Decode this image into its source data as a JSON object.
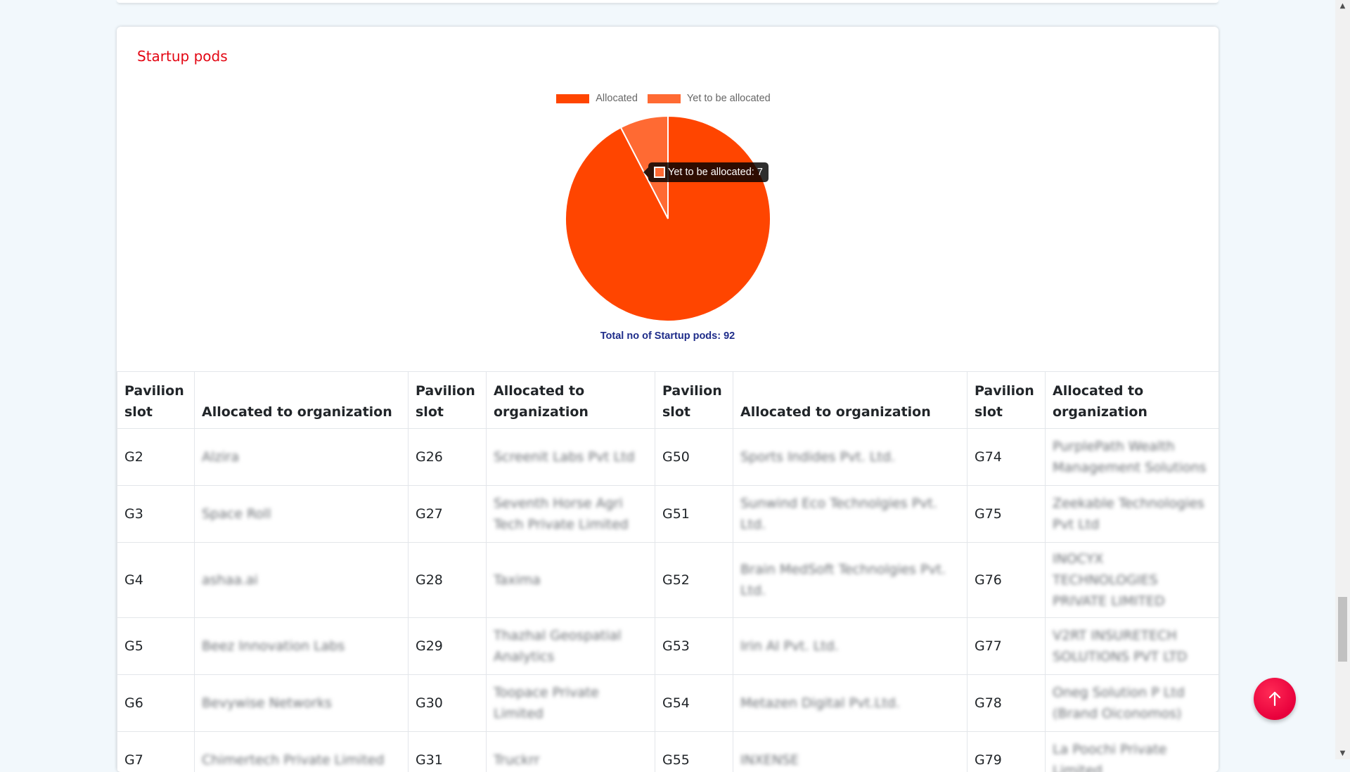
{
  "section": {
    "title": "Startup pods"
  },
  "chart_data": {
    "type": "pie",
    "labels": [
      "Allocated",
      "Yet to be allocated"
    ],
    "values": [
      85,
      7
    ],
    "colors": [
      "#ff4500",
      "#ff6a33"
    ],
    "legend_position": "top",
    "tooltip": "Yet to be allocated: 7",
    "caption": "Total no of Startup pods: 92"
  },
  "table": {
    "headers": [
      "Pavilion slot",
      "Allocated to organization",
      "Pavilion slot",
      "Allocated to organization",
      "Pavilion slot",
      "Allocated to organization",
      "Pavilion slot",
      "Allocated to organization"
    ],
    "rows": [
      [
        "G2",
        "Alzira",
        "G26",
        "Screenit Labs Pvt Ltd",
        "G50",
        "Sports Indides Pvt. Ltd.",
        "G74",
        "PurplePath Wealth Management Solutions"
      ],
      [
        "G3",
        "Space Roll",
        "G27",
        "Seventh Horse Agri Tech Private Limited",
        "G51",
        "Sunwind Eco Technolgies Pvt. Ltd.",
        "G75",
        "Zeekable Technologies Pvt Ltd"
      ],
      [
        "G4",
        "ashaa.ai",
        "G28",
        "Taxima",
        "G52",
        "Brain MedSoft Technolgies Pvt. Ltd.",
        "G76",
        "INOCYX TECHNOLOGIES PRIVATE LIMITED"
      ],
      [
        "G5",
        "Beez Innovation Labs",
        "G29",
        "Thazhal Geospatial Analytics",
        "G53",
        "Irin AI Pvt. Ltd.",
        "G77",
        "V2RT INSURETECH SOLUTIONS PVT LTD"
      ],
      [
        "G6",
        "Bevywise Networks",
        "G30",
        "Toopace Private Limited",
        "G54",
        "Metazen Digital Pvt.Ltd.",
        "G78",
        "Oneg Solution P Ltd (Brand Oiconomos)"
      ],
      [
        "G7",
        "Chimertech Private Limited",
        "G31",
        "Truckrr",
        "G55",
        "INXENSE",
        "G79",
        "La Poochi Private Limited"
      ]
    ]
  },
  "ui": {
    "scroll_top_icon": "arrow-up-icon"
  }
}
